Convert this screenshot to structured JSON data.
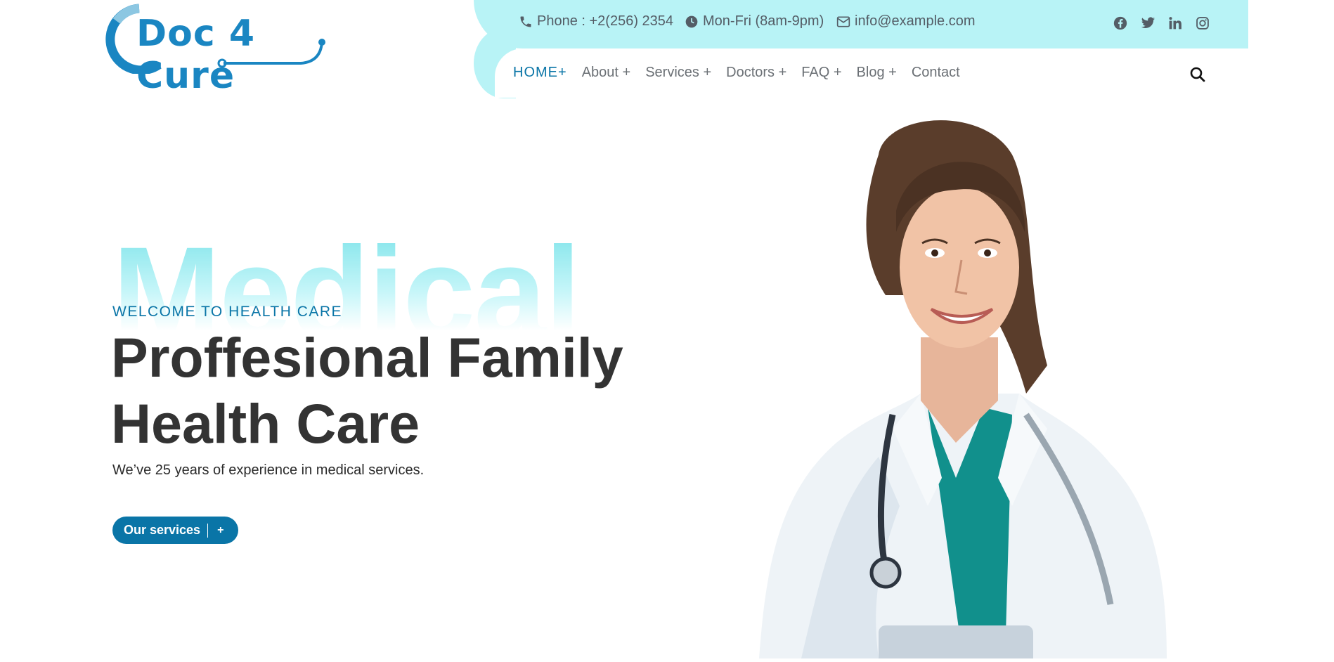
{
  "brand": {
    "name": "Doc 4 Cure",
    "color": "#1a86c2"
  },
  "topbar": {
    "phone": "Phone : +2(256) 2354",
    "hours": "Mon-Fri (8am-9pm)",
    "email": "info@example.com",
    "socials": [
      "facebook-icon",
      "twitter-icon",
      "linkedin-icon",
      "instagram-icon"
    ]
  },
  "nav": {
    "items": [
      {
        "label": "HOME+"
      },
      {
        "label": "About +"
      },
      {
        "label": "Services +"
      },
      {
        "label": "Doctors +"
      },
      {
        "label": "FAQ +"
      },
      {
        "label": "Blog +"
      },
      {
        "label": "Contact"
      }
    ]
  },
  "hero": {
    "bg_word": "Medical",
    "eyebrow": "WELCOME TO HEALTH CARE",
    "headline": "Proffesional Family Health Care",
    "subtext": "We’ve 25 years of experience in medical services.",
    "button_label": "Our services",
    "button_plus": "+"
  },
  "colors": {
    "accent": "#0a75a7",
    "topbar_bg": "#b8f3f6",
    "headline": "#333333"
  }
}
